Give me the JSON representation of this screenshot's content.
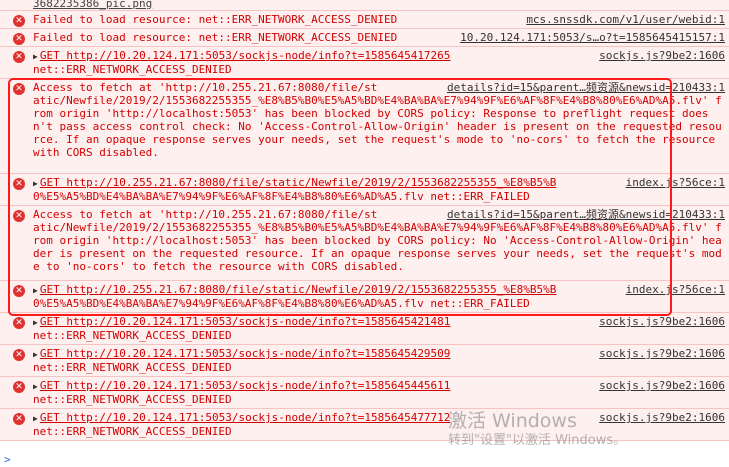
{
  "console": {
    "top_partial": "3682235386_pic.png",
    "messages": [
      {
        "text": "Failed to load resource: net::ERR_NETWORK_ACCESS_DENIED",
        "source": "mcs.snssdk.com/v1/user/webid:1"
      },
      {
        "text": "Failed to load resource: net::ERR_NETWORK_ACCESS_DENIED",
        "source": "10.20.124.171:5053/s…o?t=1585645415157:1"
      },
      {
        "line1": "GET http://10.20.124.171:5053/sockjs-node/info?t=1585645417265",
        "source": "sockjs.js?9be2:1606",
        "line2": "net::ERR_NETWORK_ACCESS_DENIED"
      },
      {
        "line1": "Access to fetch at 'http://10.255.21.67:8080/file/st",
        "source": "details?id=15&parent…频资源&newsid=210433:1",
        "rest": "atic/Newfile/2019/2/1553682255355_%E8%B5%B0%E5%A5%BD%E4%BA%BA%E7%94%9F%E6%AF%8F%E4%B8%80%E6%AD%A5.flv' from origin 'http://localhost:5053' has been blocked by CORS policy: Response to preflight request doesn't pass access control check: No 'Access-Control-Allow-Origin' header is present on the requested resource. If an opaque response serves your needs, set the request's mode to 'no-cors' to fetch the resource with CORS disabled."
      },
      {
        "line1": "GET http://10.255.21.67:8080/file/static/Newfile/2019/2/1553682255355_%E8%B5%B",
        "source": "index.js?56ce:1",
        "line2": "0%E5%A5%BD%E4%BA%BA%E7%94%9F%E6%AF%8F%E4%B8%80%E6%AD%A5.flv net::ERR_FAILED"
      },
      {
        "line1": "Access to fetch at 'http://10.255.21.67:8080/file/st",
        "source": "details?id=15&parent…频资源&newsid=210433:1",
        "rest": "atic/Newfile/2019/2/1553682255355_%E8%B5%B0%E5%A5%BD%E4%BA%BA%E7%94%9F%E6%AF%8F%E4%B8%80%E6%AD%A5.flv' from origin 'http://localhost:5053' has been blocked by CORS policy: No 'Access-Control-Allow-Origin' header is present on the requested resource. If an opaque response serves your needs, set the request's mode to 'no-cors' to fetch the resource with CORS disabled."
      },
      {
        "line1": "GET http://10.255.21.67:8080/file/static/Newfile/2019/2/1553682255355_%E8%B5%B",
        "source": "index.js?56ce:1",
        "line2": "0%E5%A5%BD%E4%BA%BA%E7%94%9F%E6%AF%8F%E4%B8%80%E6%AD%A5.flv net::ERR_FAILED"
      },
      {
        "line1": "GET http://10.20.124.171:5053/sockjs-node/info?t=1585645421481",
        "source": "sockjs.js?9be2:1606",
        "line2": "net::ERR_NETWORK_ACCESS_DENIED"
      },
      {
        "line1": "GET http://10.20.124.171:5053/sockjs-node/info?t=1585645429509",
        "source": "sockjs.js?9be2:1606",
        "line2": "net::ERR_NETWORK_ACCESS_DENIED"
      },
      {
        "line1": "GET http://10.20.124.171:5053/sockjs-node/info?t=1585645445611",
        "source": "sockjs.js?9be2:1606",
        "line2": "net::ERR_NETWORK_ACCESS_DENIED"
      },
      {
        "line1": "GET http://10.20.124.171:5053/sockjs-node/info?t=1585645477712",
        "source": "sockjs.js?9be2:1606",
        "line2": "net::ERR_NETWORK_ACCESS_DENIED"
      }
    ],
    "prompt_symbol": ">"
  },
  "watermark": {
    "line1": "激活 Windows",
    "line2": "转到\"设置\"以激活 Windows。"
  },
  "colors": {
    "error_bg": "#fff0f0",
    "error_text": "#d20000",
    "error_icon": "#e0322f",
    "highlight_box": "#ff1a1a"
  },
  "icons": {
    "error": "error-circle-icon",
    "expand": "triangle-right-icon"
  }
}
